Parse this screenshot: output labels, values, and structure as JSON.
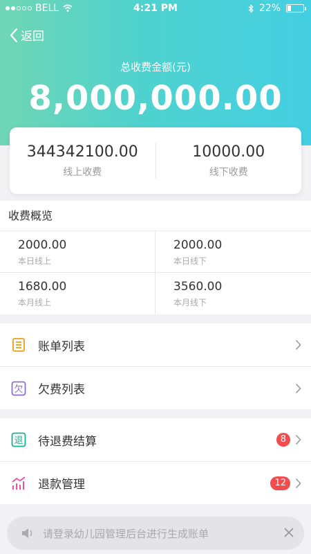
{
  "status_bar": {
    "carrier": "BELL",
    "time": "4:21 PM",
    "battery_text": "22%",
    "battery_level": 0.22
  },
  "nav": {
    "back_label": "返回"
  },
  "summary": {
    "total_label": "总收费金额(元)",
    "total_amount": "8,000,000.00",
    "online_amount": "344342100.00",
    "online_label": "线上收费",
    "offline_amount": "10000.00",
    "offline_label": "线下收费"
  },
  "overview": {
    "title": "收费概览",
    "cells": [
      {
        "value": "2000.00",
        "label": "本日线上"
      },
      {
        "value": "2000.00",
        "label": "本日线下"
      },
      {
        "value": "1680.00",
        "label": "本月线上"
      },
      {
        "value": "3560.00",
        "label": "本月线下"
      }
    ]
  },
  "menu": {
    "bill_list": "账单列表",
    "arrears_list": "欠费列表",
    "pending_refund": "待退费结算",
    "pending_refund_badge": "8",
    "refund_manage": "退款管理",
    "refund_manage_badge": "12",
    "arrears_icon_char": "欠",
    "refund_icon_char": "退"
  },
  "notice": {
    "text": "请登录幼儿园管理后台进行生成账单"
  },
  "colors": {
    "gradient_start": "#6fd6b3",
    "gradient_end": "#44cfe2",
    "badge": "#f24c4c",
    "bill_icon": "#f39c12",
    "arrears_icon": "#8e6bd8",
    "refund_icon": "#1aaf8f",
    "refund_manage_icon": "#f0529a"
  },
  "icons": {
    "back": "chevron-left-icon",
    "bill": "bill-list-icon",
    "arrears": "arrears-icon",
    "refund": "refund-icon",
    "refund_manage": "chart-icon",
    "speaker": "speaker-icon",
    "close": "close-icon"
  }
}
